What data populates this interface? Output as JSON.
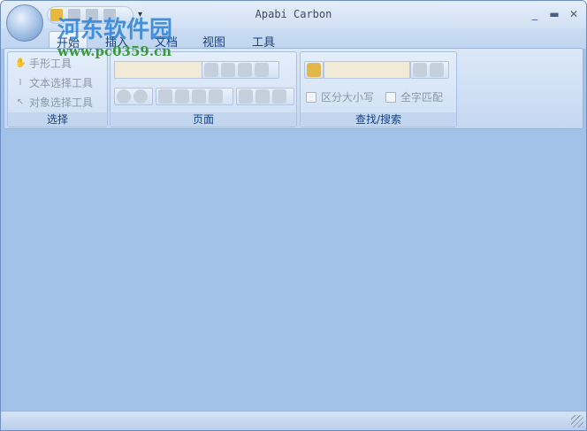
{
  "window": {
    "title": "Apabi Carbon",
    "minimize": "_",
    "maximize": "▬",
    "close": "✕",
    "qat_dropdown": "▾"
  },
  "watermark": {
    "name": "河东软件园",
    "url": "www.pc0359.cn"
  },
  "tabs": [
    {
      "label": "开始"
    },
    {
      "label": "插入"
    },
    {
      "label": "文档"
    },
    {
      "label": "视图"
    },
    {
      "label": "工具"
    }
  ],
  "groups": {
    "select": {
      "label": "选择",
      "tools": [
        {
          "label": "手形工具"
        },
        {
          "label": "文本选择工具"
        },
        {
          "label": "对象选择工具"
        }
      ]
    },
    "page": {
      "label": "页面",
      "page_input": ""
    },
    "search": {
      "label": "查找/搜索",
      "search_input": "",
      "match_case": "区分大小写",
      "whole_word": "全字匹配"
    }
  }
}
